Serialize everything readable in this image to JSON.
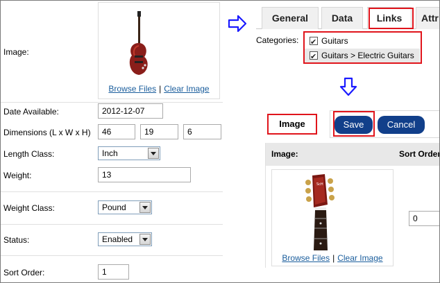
{
  "form": {
    "image_label": "Image:",
    "browse_files": "Browse Files",
    "separator": "|",
    "clear_image": "Clear Image",
    "date_available_label": "Date Available:",
    "date_available_value": "2012-12-07",
    "dimensions_label": "Dimensions (L x W x H)",
    "length_value": "46",
    "width_value": "19",
    "height_value": "6",
    "length_class_label": "Length Class:",
    "length_class_value": "Inch",
    "weight_label": "Weight:",
    "weight_value": "13",
    "weight_class_label": "Weight Class:",
    "weight_class_value": "Pound",
    "status_label": "Status:",
    "status_value": "Enabled",
    "sort_order_label": "Sort Order:",
    "sort_order_value": "1"
  },
  "tabs": [
    {
      "label": "General"
    },
    {
      "label": "Data"
    },
    {
      "label": "Links"
    },
    {
      "label": "Attr"
    }
  ],
  "categories": {
    "label": "Categories:",
    "items": [
      {
        "label": "Guitars",
        "checked": true
      },
      {
        "label": "Guitars > Electric Guitars",
        "checked": true
      }
    ]
  },
  "image_tab": {
    "label": "Image"
  },
  "buttons": {
    "save": "Save",
    "cancel": "Cancel"
  },
  "image_panel": {
    "col_image": "Image:",
    "col_sort_order": "Sort Order",
    "browse_files": "Browse Files",
    "separator": "|",
    "clear_image": "Clear Image",
    "sort_order_value": "0"
  },
  "colors": {
    "highlight_red": "#e0141b",
    "button_blue": "#113f8a",
    "link_blue": "#1a5d9c",
    "arrow_blue": "#1a1aff"
  },
  "icons": [
    "arrow-right-icon",
    "arrow-down-icon",
    "checkbox-icon",
    "dropdown-arrow-icon"
  ]
}
